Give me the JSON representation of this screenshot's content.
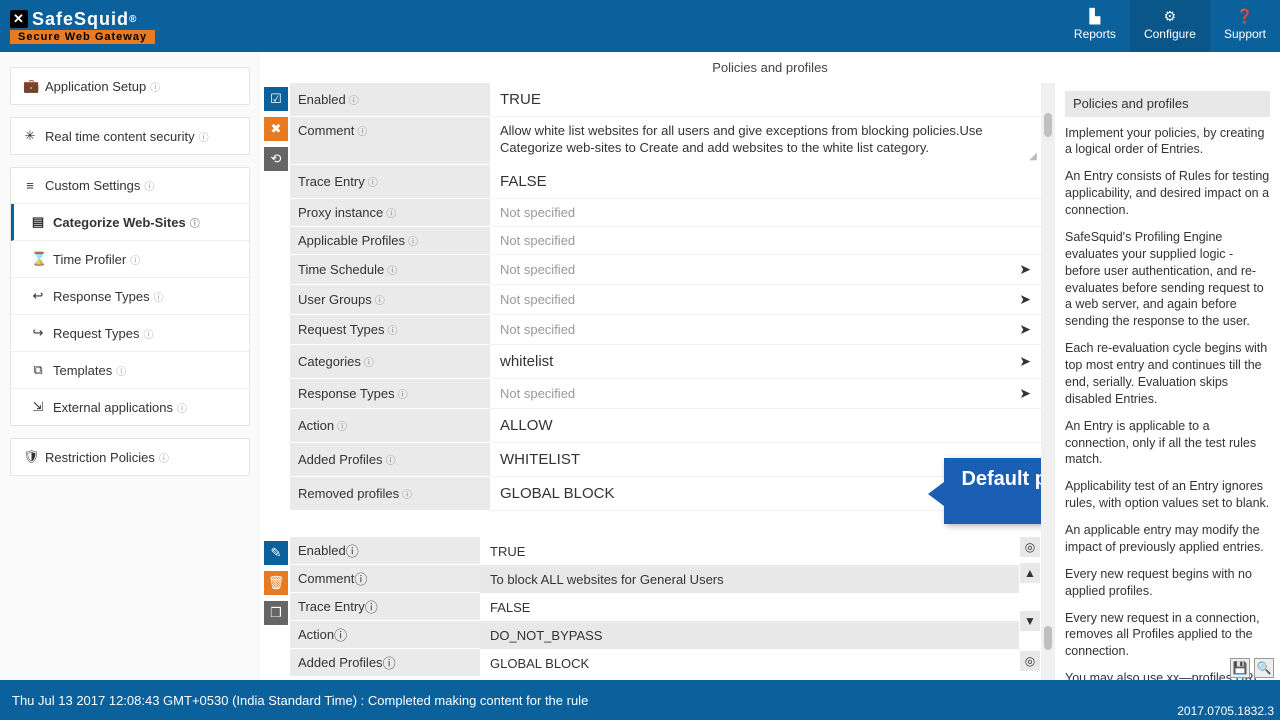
{
  "brand": {
    "name": "SafeSquid",
    "reg": "®",
    "tagline": "Secure Web Gateway"
  },
  "header_nav": {
    "reports": "Reports",
    "configure": "Configure",
    "support": "Support"
  },
  "sidebar": {
    "app_setup": "Application Setup",
    "rtcs": "Real time content security",
    "custom": "Custom Settings",
    "categorize": "Categorize Web-Sites",
    "time_profiler": "Time Profiler",
    "response_types": "Response Types",
    "request_types": "Request Types",
    "templates": "Templates",
    "external_apps": "External applications",
    "restriction": "Restriction Policies"
  },
  "content_title": "Policies and profiles",
  "form1": {
    "enabled_label": "Enabled",
    "enabled_value": "TRUE",
    "comment_label": "Comment",
    "comment_value": "Allow white list websites for all users and give exceptions from blocking policies.Use Categorize web-sites to Create and add websites to the white list category.",
    "trace_label": "Trace Entry",
    "trace_value": "FALSE",
    "proxy_label": "Proxy instance",
    "proxy_value": "Not specified",
    "applicable_label": "Applicable Profiles",
    "applicable_value": "Not specified",
    "tsched_label": "Time Schedule",
    "tsched_value": "Not specified",
    "ugroups_label": "User Groups",
    "ugroups_value": "Not specified",
    "reqtypes_label": "Request Types",
    "reqtypes_value": "Not specified",
    "categories_label": "Categories",
    "categories_value": "whitelist",
    "resptypes_label": "Response Types",
    "resptypes_value": "Not specified",
    "action_label": "Action",
    "action_value": "ALLOW",
    "added_label": "Added Profiles",
    "added_value": "WHITELIST",
    "removed_label": "Removed profiles",
    "removed_value": "GLOBAL BLOCK"
  },
  "form2": {
    "enabled_label": "Enabled",
    "enabled_value": "TRUE",
    "comment_label": "Comment",
    "comment_value": "To block ALL websites for General Users",
    "trace_label": "Trace Entry",
    "trace_value": "FALSE",
    "action_label": "Action",
    "action_value": "DO_NOT_BYPASS",
    "added_label": "Added Profiles",
    "added_value": "GLOBAL BLOCK"
  },
  "callout": "Default profile with unique name",
  "right": {
    "title": "Policies and profiles",
    "p1": "Implement your policies, by creating a logical order of Entries.",
    "p2": "An Entry consists of Rules for testing applicability, and desired impact on a connection.",
    "p3": "SafeSquid's Profiling Engine evaluates your supplied logic - before user authentication, and re-evaluates before sending request to a web server, and again before sending the response to the user.",
    "p4": "Each re-evaluation cycle begins with top most entry and continues till the end, serially. Evaluation skips disabled Entries.",
    "p5": "An Entry is applicable to a connection, only if all the test rules match.",
    "p6": "Applicability test of an Entry ignores rules, with option values set to blank.",
    "p7": "An applicable entry may modify the impact of previously applied entries.",
    "p8": "Every new request begins with no applied profiles.",
    "p9": "Every new request in a connection, removes all Profiles applied to the connection.",
    "p10": "You may also use xx—profiles URL command to check applied profiles."
  },
  "footer": {
    "status": "Thu Jul 13 2017 12:08:43 GMT+0530 (India Standard Time) : Completed making content for the rule",
    "version": "2017.0705.1832.3"
  }
}
